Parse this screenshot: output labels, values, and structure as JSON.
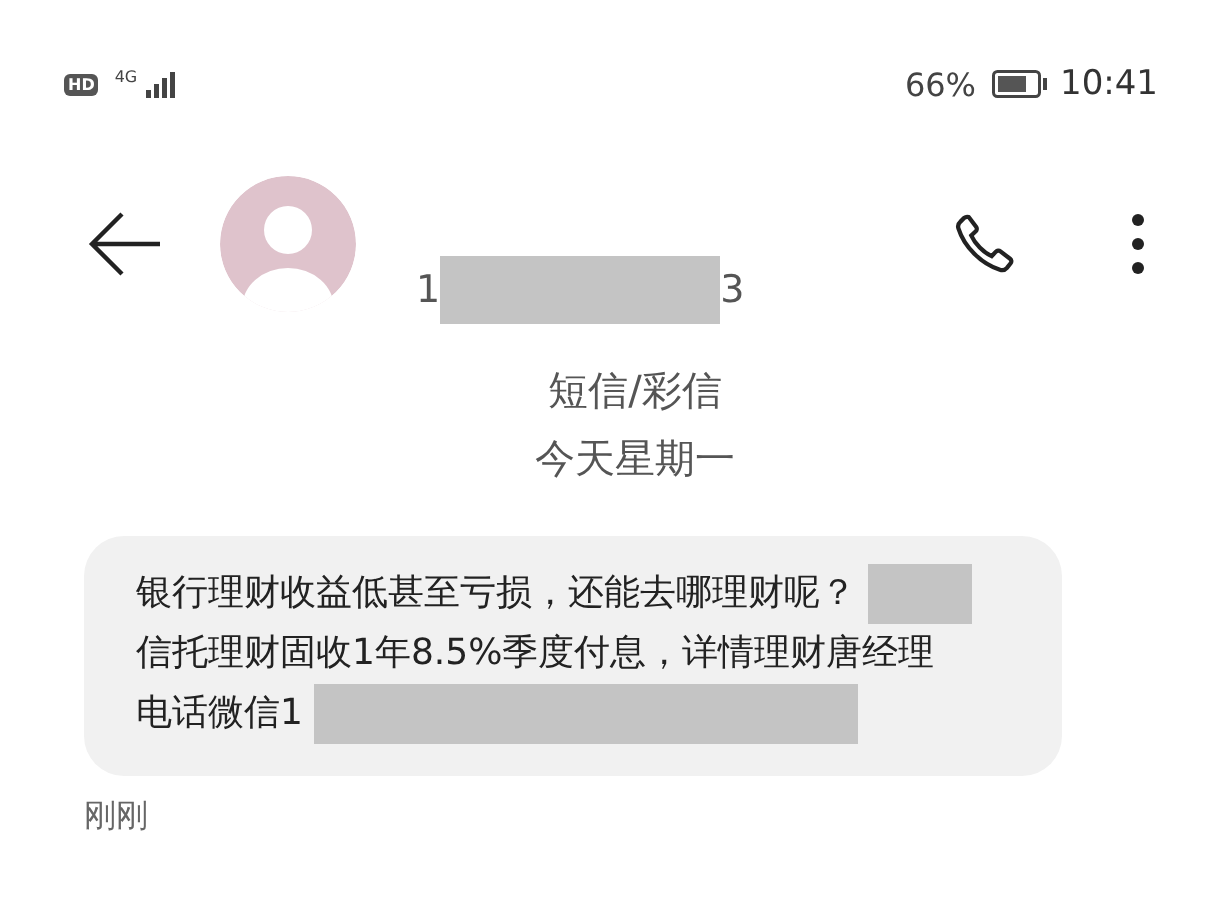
{
  "status_bar": {
    "hd": "HD",
    "network": "4G",
    "battery_percent": "66%",
    "time": "10:41"
  },
  "header": {
    "number_start": "1",
    "number_redacted": true,
    "number_end": "3"
  },
  "thread": {
    "type": "短信/彩信",
    "date": "今天星期一"
  },
  "messages": [
    {
      "lines": [
        {
          "text": "银行理财收益低甚至亏损，还能去哪理财呢？",
          "redacted": true
        },
        {
          "text": "信托理财固收1年8.5%季度付息，详情理财唐经理",
          "redacted": false
        },
        {
          "text": "电话微信1",
          "redacted": true
        }
      ],
      "time": "刚刚"
    }
  ]
}
